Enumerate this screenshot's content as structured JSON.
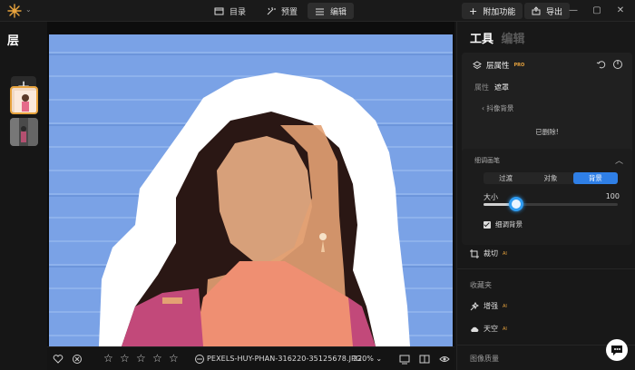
{
  "topbar": {
    "tabs": [
      {
        "label": "目录",
        "icon": "catalog-icon",
        "active": false
      },
      {
        "label": "预置",
        "icon": "presets-icon",
        "active": false
      },
      {
        "label": "编辑",
        "icon": "edit-icon",
        "active": true
      }
    ],
    "addon_label": "附加功能",
    "export_label": "导出"
  },
  "layers": {
    "title": "层",
    "add_symbol": "+"
  },
  "bottombar": {
    "filename": "PEXELS-HUY-PHAN-316220-35125678.JPG",
    "zoom": "220%",
    "zoom_caret": "⌄",
    "rating": 0
  },
  "panel": {
    "tab_tools": "工具",
    "tab_edit": "编辑",
    "layer_props_title": "层属性",
    "pro_tag": "PRO",
    "sub_tab_props": "属性",
    "sub_tab_mask": "遮罩",
    "back_link": "‹  抖像背景",
    "deleted_text": "已删除!",
    "refine_title": "细调画笔",
    "refine_caret": "︿",
    "segments": [
      "过渡",
      "对象",
      "背景"
    ],
    "active_segment": 2,
    "size_label": "大小",
    "size_value": "100",
    "size_fraction": 0.24,
    "refine_bg_label": "细调背景",
    "crop_label": "裁切",
    "ai_tag": "AI",
    "favorites_label": "收藏夹",
    "enhance_label": "增强",
    "sky_label": "天空",
    "image_quality_label": "图像质量"
  },
  "colors": {
    "accent_blue": "#2f7fe6",
    "accent_orange": "#e8a33d",
    "background": "#151515"
  }
}
